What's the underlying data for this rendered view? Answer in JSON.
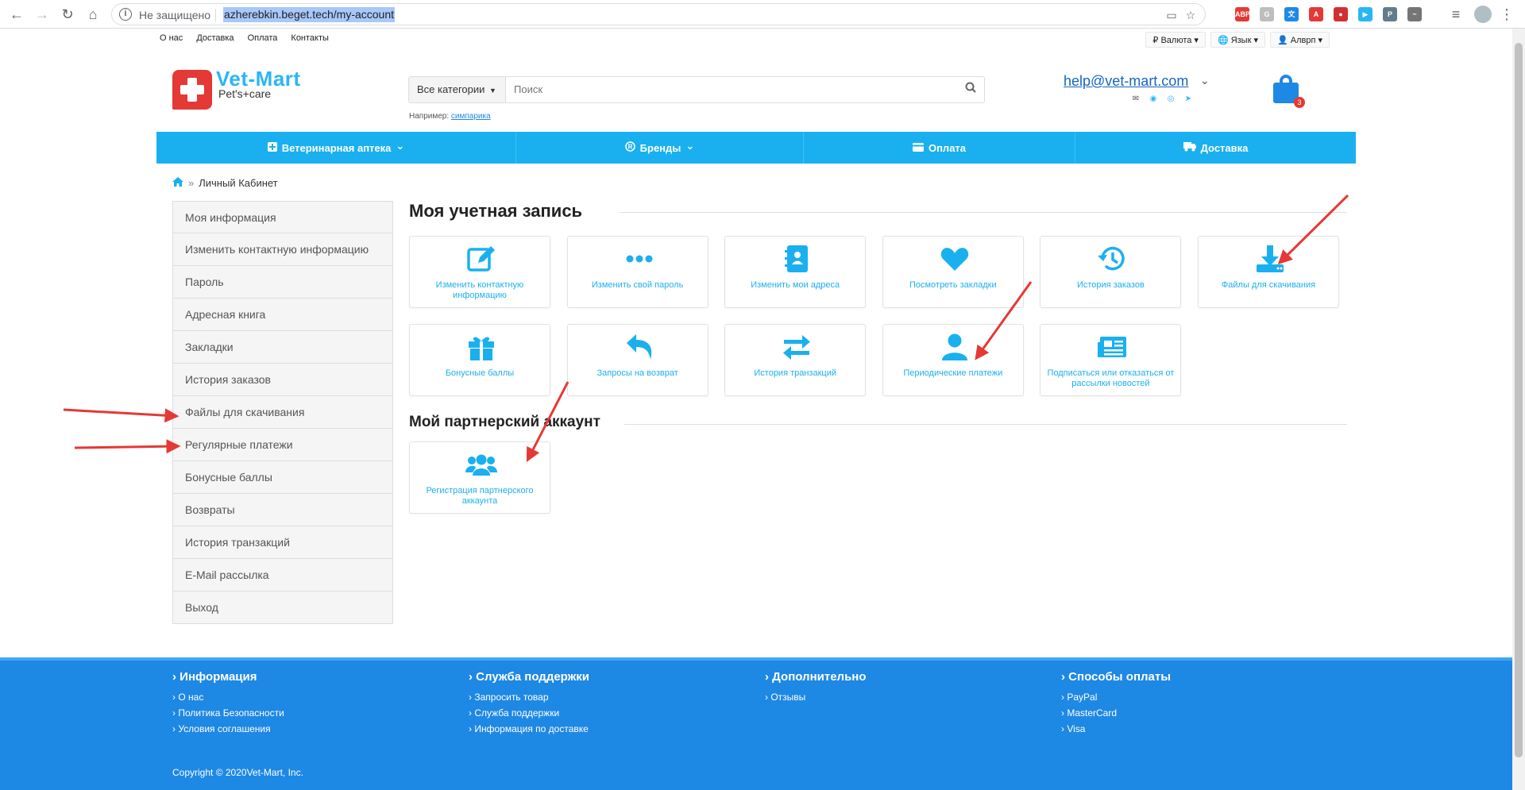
{
  "browser": {
    "insecure_label": "Не защищено",
    "url": "azherebkin.beget.tech/my-account",
    "extensions": [
      {
        "name": "adblock-icon",
        "text": "ABP",
        "color": "#e53935"
      },
      {
        "name": "gmail-icon",
        "text": "G",
        "color": "#bdbdbd"
      },
      {
        "name": "translate-icon",
        "text": "文",
        "color": "#1e88e5"
      },
      {
        "name": "pdf-icon",
        "text": "A",
        "color": "#e53935"
      },
      {
        "name": "record-icon",
        "text": "●",
        "color": "#d32f2f"
      },
      {
        "name": "play-icon",
        "text": "▶",
        "color": "#29b6f6"
      },
      {
        "name": "pocket-icon",
        "text": "P",
        "color": "#607d8b"
      },
      {
        "name": "mask-icon",
        "text": "~",
        "color": "#757575"
      }
    ]
  },
  "topbar": {
    "links": [
      "О нас",
      "Доставка",
      "Оплата",
      "Контакты"
    ],
    "currency": "₽ Валюта ▾",
    "language": "🌐 Язык ▾",
    "account": "👤 Алврп ▾"
  },
  "header": {
    "logo_name": "Vet-Mart",
    "logo_tagline": "Pet's+care",
    "search_category": "Все категории",
    "search_placeholder": "Поиск",
    "example_label": "Например:",
    "example_link": "симпарика",
    "email": "help@vet-mart.com",
    "cart_count": "3"
  },
  "menu": [
    {
      "icon": "plus-square-icon",
      "label": "Ветеринарная аптека",
      "caret": true
    },
    {
      "icon": "registered-icon",
      "label": "Бренды",
      "caret": true
    },
    {
      "icon": "card-icon",
      "label": "Оплата",
      "caret": false
    },
    {
      "icon": "truck-icon",
      "label": "Доставка",
      "caret": false
    }
  ],
  "breadcrumb": {
    "current": "Личный Кабинет"
  },
  "sidebar": [
    "Моя информация",
    "Изменить контактную информацию",
    "Пароль",
    "Адресная книга",
    "Закладки",
    "История заказов",
    "Файлы для скачивания",
    "Регулярные платежи",
    "Бонусные баллы",
    "Возвраты",
    "История транзакций",
    "E-Mail рассылка",
    "Выход"
  ],
  "account_section": {
    "title": "Моя учетная запись",
    "cards": [
      {
        "icon": "edit-icon",
        "label": "Изменить контактную информацию"
      },
      {
        "icon": "dots-icon",
        "label": "Изменить свой пароль"
      },
      {
        "icon": "address-book-icon",
        "label": "Изменить мои адреса"
      },
      {
        "icon": "heart-icon",
        "label": "Посмотреть закладки"
      },
      {
        "icon": "history-icon",
        "label": "История заказов"
      },
      {
        "icon": "download-icon",
        "label": "Файлы для скачивания"
      },
      {
        "icon": "gift-icon",
        "label": "Бонусные баллы"
      },
      {
        "icon": "return-icon",
        "label": "Запросы на возврат"
      },
      {
        "icon": "exchange-icon",
        "label": "История транзакций"
      },
      {
        "icon": "user-icon",
        "label": "Периодические платежи"
      },
      {
        "icon": "newsletter-icon",
        "label": "Подписаться или отказаться от рассылки новостей"
      }
    ]
  },
  "partner_section": {
    "title": "Мой партнерский аккаунт",
    "cards": [
      {
        "icon": "users-icon",
        "label": "Регистрация партнерского аккаунта"
      }
    ]
  },
  "footer": {
    "columns": [
      {
        "title": "Информация",
        "links": [
          "О нас",
          "Политика Безопасности",
          "Условия соглашения"
        ]
      },
      {
        "title": "Служба поддержки",
        "links": [
          "Запросить товар",
          "Служба поддержки",
          "Информация по доставке"
        ]
      },
      {
        "title": "Дополнительно",
        "links": [
          "Отзывы"
        ]
      },
      {
        "title": "Способы оплаты",
        "links": [
          "PayPal",
          "MasterCard",
          "Visa"
        ]
      }
    ],
    "copyright": "Copyright © 2020Vet-Mart, Inc."
  },
  "colors": {
    "accent": "#1ab0ef",
    "footer": "#1e88e5",
    "logo_red": "#e53935",
    "arrow": "#e53935"
  }
}
